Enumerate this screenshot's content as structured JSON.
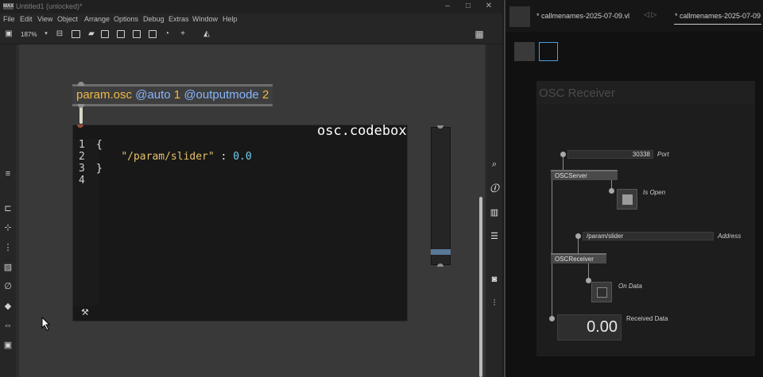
{
  "max": {
    "title": "Untitled1 (unlocked)*",
    "logo": "MAX",
    "window_controls": [
      "–",
      "□",
      "✕"
    ],
    "menu": [
      "File",
      "Edit",
      "View",
      "Object",
      "Arrange",
      "Options",
      "Debug",
      "Extras",
      "Window",
      "Help"
    ],
    "zoom": "187%",
    "param_object": {
      "name": "param.osc",
      "attr1": "@auto",
      "val1": "1",
      "attr2": "@outputmode",
      "val2": "2"
    },
    "codebox": {
      "title": "osc.codebox",
      "lines": [
        {
          "no": "1",
          "text": "{"
        },
        {
          "no": "2",
          "key": "\"/param/slider\"",
          "sep": " : ",
          "value": "0.0"
        },
        {
          "no": "3",
          "text": "}"
        },
        {
          "no": "4",
          "text": ""
        }
      ]
    },
    "slider": {
      "value": 0.08
    }
  },
  "vvvv": {
    "tab1": "* callmenames-2025-07-09.vl",
    "tab2": "* callmenames-2025-07-09",
    "group_title": "OSC Receiver",
    "port_value": "30338",
    "port_label": "Port",
    "server_node": "OSCServer",
    "is_open_label": "Is Open",
    "address_value": "/param/slider",
    "address_label": "Address",
    "receiver_node": "OSCReceiver",
    "on_data_label": "On Data",
    "received_value": "0.00",
    "received_label": "Received Data"
  }
}
